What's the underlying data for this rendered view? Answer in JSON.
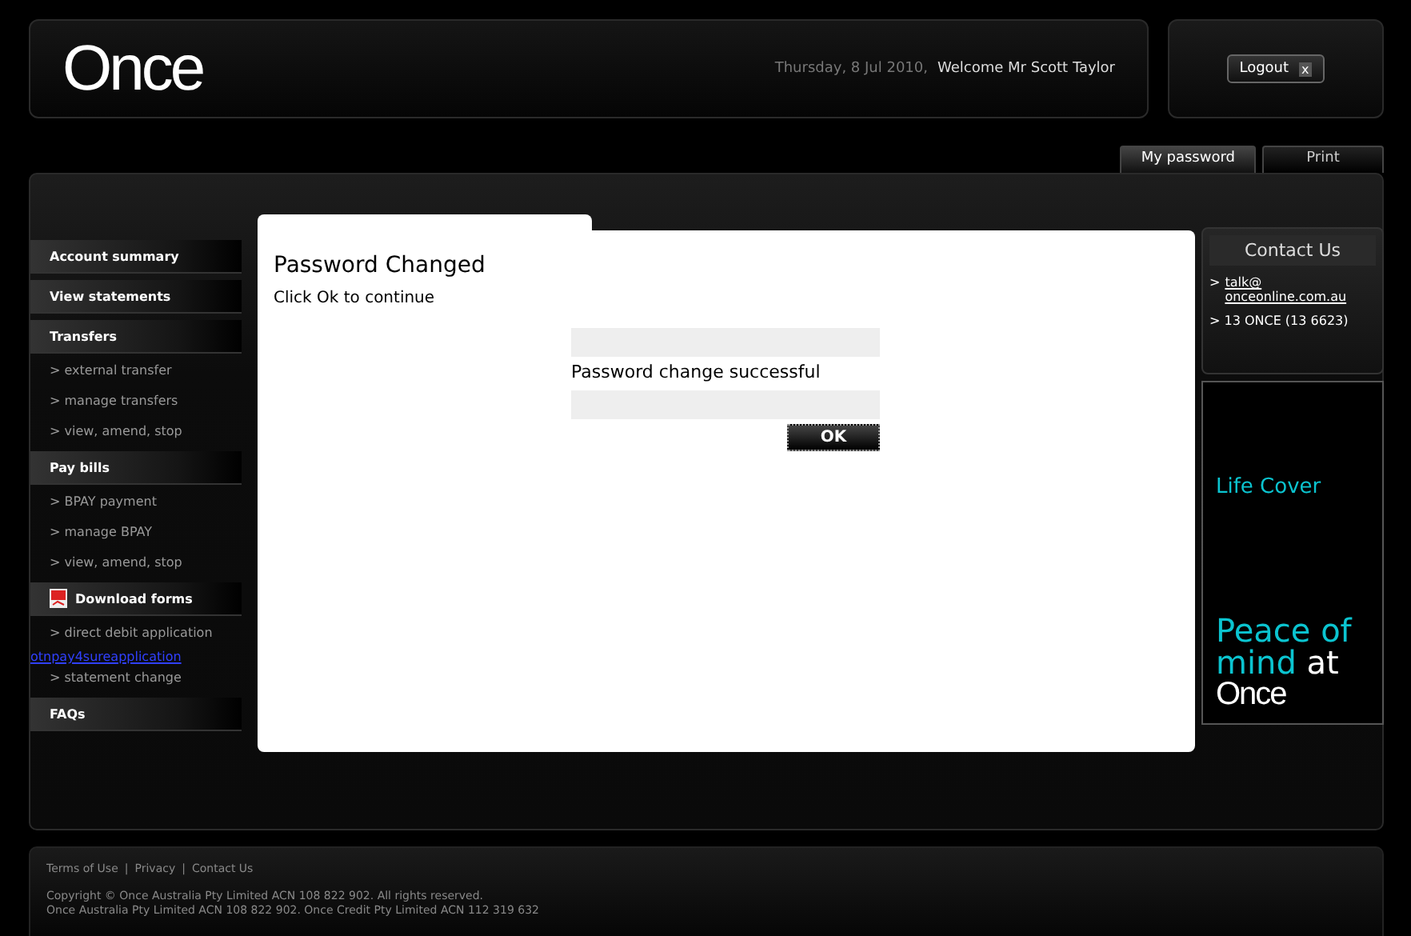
{
  "header": {
    "logo": "Once",
    "date": "Thursday, 8 Jul 2010,",
    "welcome": "Welcome Mr Scott Taylor",
    "logout": "Logout",
    "logout_icon": "x"
  },
  "top_tabs": [
    {
      "label": "My password",
      "selected": true
    },
    {
      "label": "Print",
      "selected": false
    }
  ],
  "sidebar": {
    "items": [
      {
        "kind": "heading",
        "label": "Account summary"
      },
      {
        "kind": "heading",
        "label": "View statements"
      },
      {
        "kind": "heading",
        "label": "Transfers"
      },
      {
        "kind": "link",
        "label": "> external transfer"
      },
      {
        "kind": "link",
        "label": "> manage transfers"
      },
      {
        "kind": "link",
        "label": "> view, amend, stop"
      },
      {
        "kind": "heading",
        "label": "Pay bills"
      },
      {
        "kind": "link",
        "label": "> BPAY payment"
      },
      {
        "kind": "link",
        "label": "> manage BPAY"
      },
      {
        "kind": "link",
        "label": "> view, amend, stop"
      },
      {
        "kind": "icon-heading",
        "label": "Download forms"
      },
      {
        "kind": "link",
        "label": "> direct debit application"
      },
      {
        "kind": "url",
        "label": "otnpay4sureapplication"
      },
      {
        "kind": "link",
        "label": "> statement change"
      },
      {
        "kind": "heading",
        "label": "FAQs"
      }
    ]
  },
  "dialog": {
    "title": "Password Changed",
    "instruction": "Click Ok to continue",
    "message": "Password change successful",
    "ok_button": "OK"
  },
  "contact": {
    "title": "Contact Us",
    "email_prefix": ">",
    "email": "talk@ onceonline.com.au",
    "phone": "> 13 ONCE (13 6623)"
  },
  "ad": {
    "line1": "Life Cover",
    "line2": "Peace of mind",
    "line3": "at",
    "logo": "Once"
  },
  "footer": {
    "links": [
      "Terms of Use",
      "Privacy",
      "Contact Us"
    ],
    "separator": "|",
    "copyright": [
      "Copyright © Once Australia Pty Limited ACN 108 822 902. All rights reserved.",
      "Once Australia Pty Limited ACN 108 822 902. Once Credit Pty Limited ACN 112 319 632"
    ]
  }
}
